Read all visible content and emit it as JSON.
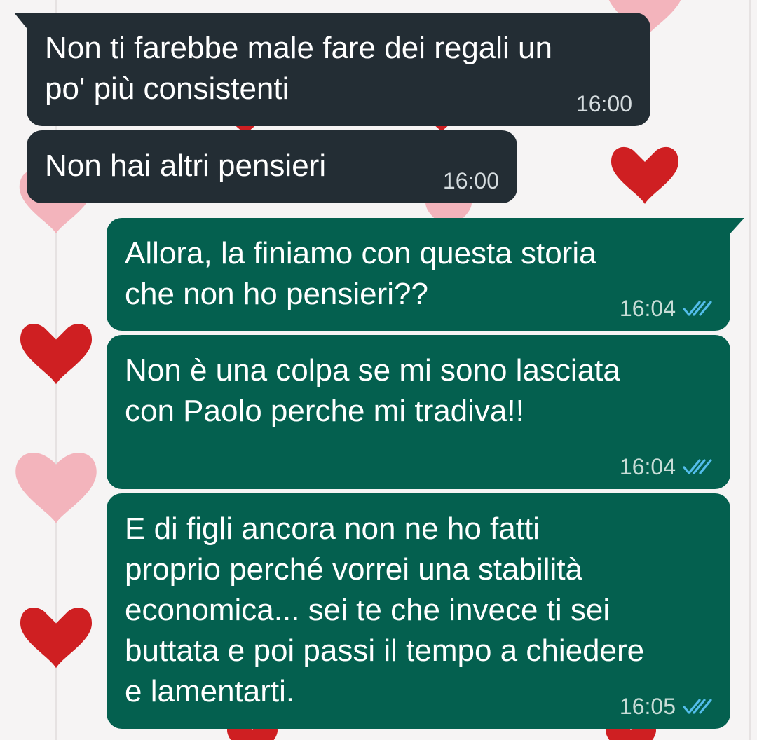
{
  "messages": [
    {
      "direction": "incoming",
      "text": "Non ti farebbe male fare dei regali un\npo' più consistenti",
      "time": "16:00"
    },
    {
      "direction": "incoming",
      "text": "Non hai altri pensieri",
      "time": "16:00"
    },
    {
      "direction": "outgoing",
      "text": "Allora, la finiamo con questa storia\nche non ho pensieri??",
      "time": "16:04",
      "status": "read"
    },
    {
      "direction": "outgoing",
      "text": "Non è una colpa se mi sono lasciata\ncon Paolo perche mi tradiva!!",
      "time": "16:04",
      "status": "read"
    },
    {
      "direction": "outgoing",
      "text": "E di figli ancora non ne ho fatti\nproprio perché vorrei una stabilità\neconomica... sei te che invece ti sei\nbuttata e poi passi il tempo a chiedere\ne lamentarti.",
      "time": "16:05",
      "status": "read"
    }
  ],
  "icons": {
    "read_receipt": "double-check-icon",
    "wallpaper": "heart-icon"
  },
  "colors": {
    "incoming_bubble": "#232d34",
    "outgoing_bubble": "#04604f",
    "read_tick": "#53bdeb",
    "heart_red": "#d41f1f",
    "heart_pink": "#f5b5bd",
    "background": "#f6f4f4"
  }
}
